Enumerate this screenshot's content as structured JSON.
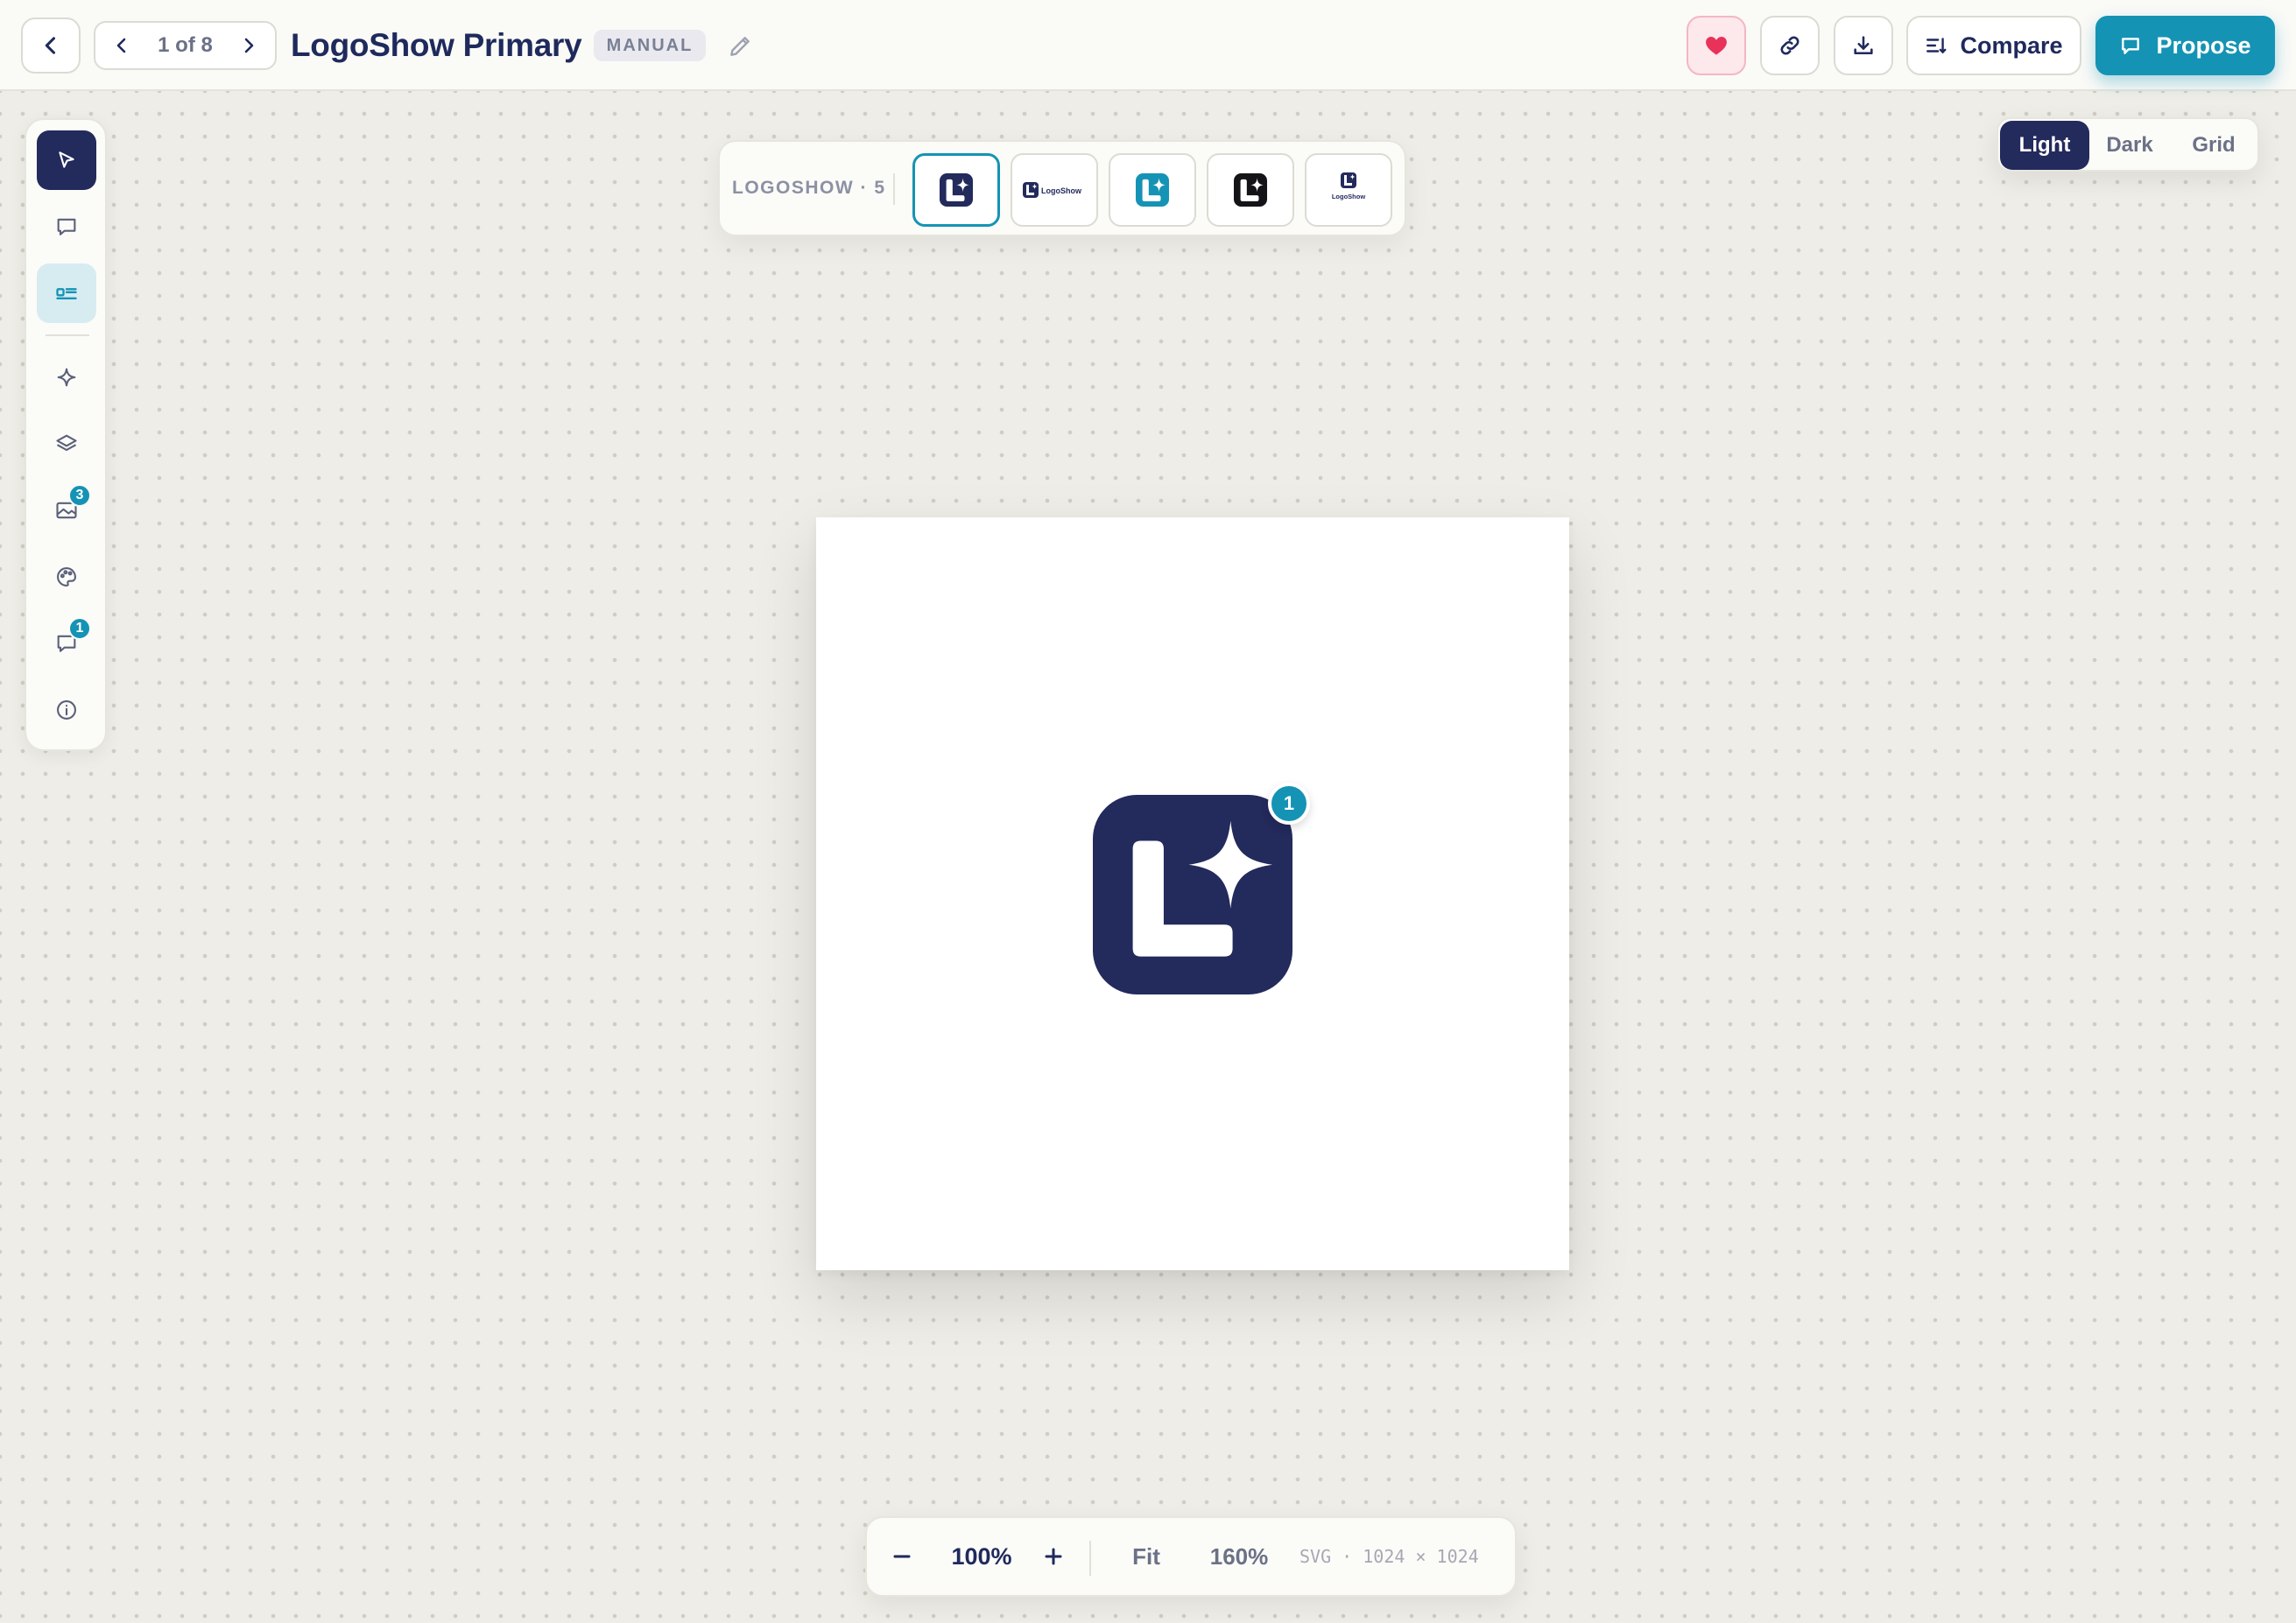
{
  "header": {
    "pager_text": "1 of 8",
    "title": "LogoShow Primary",
    "badge": "MANUAL",
    "compare_label": "Compare",
    "propose_label": "Propose",
    "icons": [
      "chevron-left-icon",
      "chevron-right-icon",
      "pencil-icon",
      "heart-icon",
      "link-icon",
      "download-icon",
      "compare-icon",
      "comment-icon"
    ]
  },
  "toolbar": {
    "items": [
      {
        "name": "select-tool",
        "icon": "cursor-arrow-icon",
        "state": "active"
      },
      {
        "name": "comment-tool",
        "icon": "speech-bubble-icon"
      },
      {
        "name": "details-tool",
        "icon": "id-card-icon",
        "state": "selected"
      },
      {
        "name": "ai-tool",
        "icon": "sparkle-icon"
      },
      {
        "name": "layers-tool",
        "icon": "layers-icon"
      },
      {
        "name": "images-tool",
        "icon": "image-icon",
        "badge": "3"
      },
      {
        "name": "palette-tool",
        "icon": "palette-icon"
      },
      {
        "name": "comments-tool",
        "icon": "chat-icon",
        "badge": "1"
      },
      {
        "name": "info-tool",
        "icon": "info-icon"
      }
    ]
  },
  "variants": {
    "label": "LOGOSHOW · 5",
    "thumb_wordmark": "LogoShow",
    "thumb_stacked_text": "LogoShow"
  },
  "view_modes": {
    "light": "Light",
    "dark": "Dark",
    "grid": "Grid",
    "active": "Light"
  },
  "canvas": {
    "comment_pin": "1"
  },
  "zoom": {
    "value": "100%",
    "fit": "Fit",
    "preset": "160%",
    "meta": "SVG · 1024 × 1024"
  },
  "colors": {
    "brand_navy": "#232a5c",
    "accent_teal": "#1593b5",
    "heart_pink": "#e8325a"
  }
}
